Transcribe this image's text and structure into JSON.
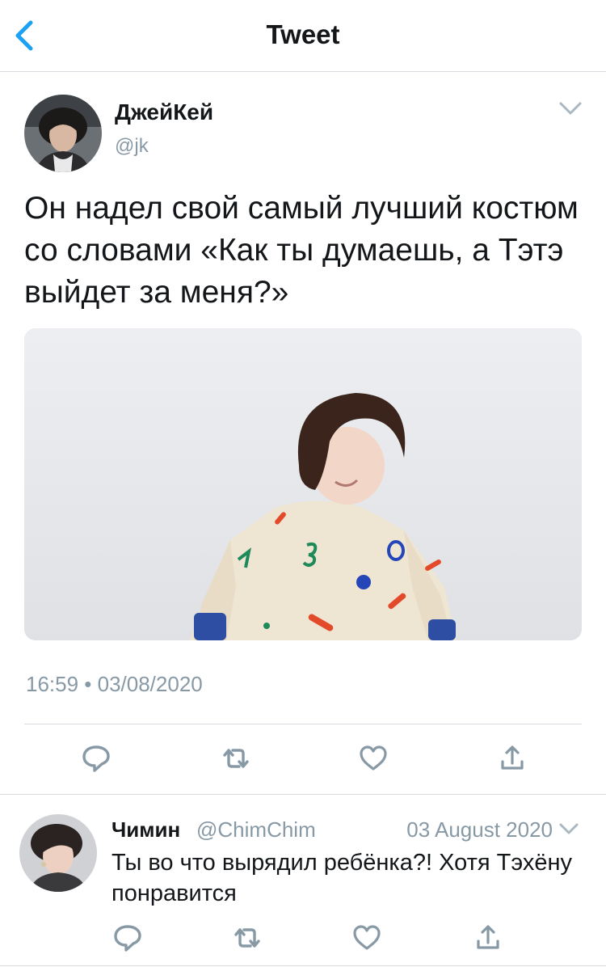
{
  "header": {
    "title": "Tweet",
    "back_icon": "chevron-left-icon"
  },
  "colors": {
    "accent": "#1da1f2",
    "secondary_text": "#8899a6",
    "divider": "#d7dbdf"
  },
  "tweet": {
    "author_name": "ДжейКей",
    "author_handle": "@jk",
    "text": "Он надел свой самый лучший костюм со словами «Как ты думаешь, а Тэтэ выйдет за меня?»",
    "timestamp": "16:59 • 03/08/2020",
    "actions": [
      "reply-icon",
      "retweet-icon",
      "like-icon",
      "share-icon"
    ]
  },
  "reply": {
    "author_name": "Чимин",
    "author_handle": "@ChimChim",
    "date": "03 August 2020",
    "text": "Ты во что вырядил ребёнка?! Хотя Тэхёну понравится",
    "actions": [
      "reply-icon",
      "retweet-icon",
      "like-icon",
      "share-icon"
    ]
  }
}
